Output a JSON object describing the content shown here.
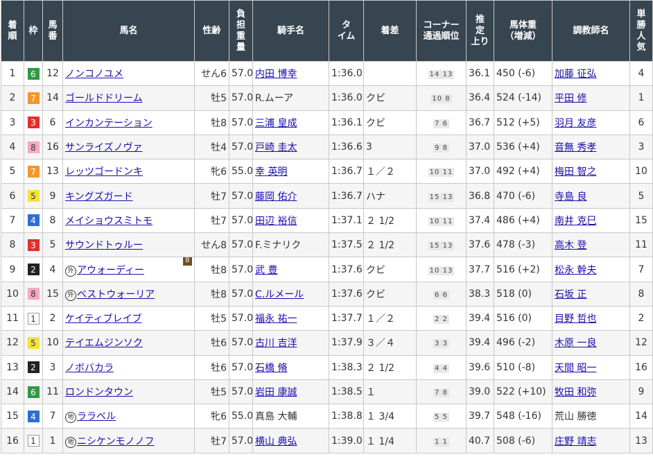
{
  "headers": [
    {
      "lines": [
        "着",
        "順"
      ]
    },
    {
      "lines": [
        "枠"
      ]
    },
    {
      "lines": [
        "馬",
        "番"
      ]
    },
    {
      "lines": [
        "馬名"
      ]
    },
    {
      "lines": [
        "性齢"
      ]
    },
    {
      "lines": [
        "負",
        "担",
        "重",
        "量"
      ]
    },
    {
      "lines": [
        "騎手名"
      ]
    },
    {
      "lines": [
        "タ",
        "イム"
      ]
    },
    {
      "lines": [
        "着差"
      ]
    },
    {
      "lines": [
        "コーナー",
        "通過順位"
      ]
    },
    {
      "lines": [
        "推",
        "定",
        "上り"
      ]
    },
    {
      "lines": [
        "馬体重",
        "（増減）"
      ]
    },
    {
      "lines": [
        "調教師名"
      ]
    },
    {
      "lines": [
        "単",
        "勝",
        "人",
        "気"
      ]
    }
  ],
  "waku_colors": {
    "1": {
      "bg": "#ffffff",
      "fg": "#333333",
      "border": "#999999"
    },
    "2": {
      "bg": "#222222",
      "fg": "#ffffff",
      "border": "#222222"
    },
    "3": {
      "bg": "#e0302c",
      "fg": "#ffffff",
      "border": "#e0302c"
    },
    "4": {
      "bg": "#2f6fcf",
      "fg": "#ffffff",
      "border": "#2f6fcf"
    },
    "5": {
      "bg": "#f5e23a",
      "fg": "#333333",
      "border": "#f5e23a"
    },
    "6": {
      "bg": "#2f9a45",
      "fg": "#ffffff",
      "border": "#2f9a45"
    },
    "7": {
      "bg": "#f5962a",
      "fg": "#ffffff",
      "border": "#f5962a"
    },
    "8": {
      "bg": "#f4a8c4",
      "fg": "#333333",
      "border": "#f4a8c4"
    }
  },
  "rows": [
    {
      "rank": "1",
      "waku": "6",
      "num": "12",
      "mark": "",
      "horse": "ノンコノユメ",
      "blinker": "",
      "sex_age": "せん6",
      "weight": "57.0",
      "jockey": "内田 博幸",
      "jockey_link": true,
      "time": "1:36.0",
      "margin": "",
      "corner": "14 13",
      "last3f": "36.1",
      "body_weight": "450 (-6)",
      "trainer": "加藤 征弘",
      "trainer_link": true,
      "pop": "4"
    },
    {
      "rank": "2",
      "waku": "7",
      "num": "14",
      "mark": "",
      "horse": "ゴールドドリーム",
      "blinker": "",
      "sex_age": "牡5",
      "weight": "57.0",
      "jockey": "R.ムーア",
      "jockey_link": false,
      "time": "1:36.0",
      "margin": "クビ",
      "corner": "10 8",
      "last3f": "36.4",
      "body_weight": "524 (-14)",
      "trainer": "平田 修",
      "trainer_link": true,
      "pop": "1"
    },
    {
      "rank": "3",
      "waku": "3",
      "num": "6",
      "mark": "",
      "horse": "インカンテーション",
      "blinker": "",
      "sex_age": "牡8",
      "weight": "57.0",
      "jockey": "三浦 皇成",
      "jockey_link": true,
      "time": "1:36.1",
      "margin": "クビ",
      "corner": "7 6",
      "last3f": "36.7",
      "body_weight": "512 (+5)",
      "trainer": "羽月 友彦",
      "trainer_link": true,
      "pop": "6"
    },
    {
      "rank": "4",
      "waku": "8",
      "num": "16",
      "mark": "",
      "horse": "サンライズノヴァ",
      "blinker": "",
      "sex_age": "牡4",
      "weight": "57.0",
      "jockey": "戸崎 圭太",
      "jockey_link": true,
      "time": "1:36.6",
      "margin": "3",
      "corner": "9 8",
      "last3f": "37.0",
      "body_weight": "536 (+4)",
      "trainer": "音無 秀孝",
      "trainer_link": true,
      "pop": "3"
    },
    {
      "rank": "5",
      "waku": "7",
      "num": "13",
      "mark": "",
      "horse": "レッツゴードンキ",
      "blinker": "",
      "sex_age": "牝6",
      "weight": "55.0",
      "jockey": "幸 英明",
      "jockey_link": true,
      "time": "1:36.7",
      "margin": "１／２",
      "corner": "10 11",
      "last3f": "37.0",
      "body_weight": "492 (+4)",
      "trainer": "梅田 智之",
      "trainer_link": true,
      "pop": "10"
    },
    {
      "rank": "6",
      "waku": "5",
      "num": "9",
      "mark": "",
      "horse": "キングズガード",
      "blinker": "",
      "sex_age": "牡7",
      "weight": "57.0",
      "jockey": "藤岡 佑介",
      "jockey_link": true,
      "time": "1:36.7",
      "margin": "ハナ",
      "corner": "15 13",
      "last3f": "36.8",
      "body_weight": "470 (-6)",
      "trainer": "寺島 良",
      "trainer_link": true,
      "pop": "5"
    },
    {
      "rank": "7",
      "waku": "4",
      "num": "8",
      "mark": "",
      "horse": "メイショウスミトモ",
      "blinker": "",
      "sex_age": "牡7",
      "weight": "57.0",
      "jockey": "田辺 裕信",
      "jockey_link": true,
      "time": "1:37.1",
      "margin": "２ 1/2",
      "corner": "10 11",
      "last3f": "37.4",
      "body_weight": "486 (+4)",
      "trainer": "南井 克巳",
      "trainer_link": true,
      "pop": "15"
    },
    {
      "rank": "8",
      "waku": "3",
      "num": "5",
      "mark": "",
      "horse": "サウンドトゥルー",
      "blinker": "",
      "sex_age": "せん8",
      "weight": "57.0",
      "jockey": "F.ミナリク",
      "jockey_link": false,
      "time": "1:37.5",
      "margin": "２ 1/2",
      "corner": "15 13",
      "last3f": "37.6",
      "body_weight": "478 (-3)",
      "trainer": "高木 登",
      "trainer_link": true,
      "pop": "11"
    },
    {
      "rank": "9",
      "waku": "2",
      "num": "4",
      "mark": "外",
      "horse": "アウォーディー",
      "blinker": "B",
      "sex_age": "牡8",
      "weight": "57.0",
      "jockey": "武 豊",
      "jockey_link": true,
      "time": "1:37.6",
      "margin": "クビ",
      "corner": "10 13",
      "last3f": "37.7",
      "body_weight": "516 (+2)",
      "trainer": "松永 幹夫",
      "trainer_link": true,
      "pop": "7"
    },
    {
      "rank": "10",
      "waku": "8",
      "num": "15",
      "mark": "外",
      "horse": "ベストウォーリア",
      "blinker": "",
      "sex_age": "牡8",
      "weight": "57.0",
      "jockey": "C.ルメール",
      "jockey_link": true,
      "time": "1:37.6",
      "margin": "クビ",
      "corner": "6 6",
      "last3f": "38.3",
      "body_weight": "518 (0)",
      "trainer": "石坂 正",
      "trainer_link": true,
      "pop": "8"
    },
    {
      "rank": "11",
      "waku": "1",
      "num": "2",
      "mark": "",
      "horse": "ケイティブレイブ",
      "blinker": "",
      "sex_age": "牡5",
      "weight": "57.0",
      "jockey": "福永 祐一",
      "jockey_link": true,
      "time": "1:37.7",
      "margin": "１／２",
      "corner": "2 2",
      "last3f": "39.4",
      "body_weight": "516 (0)",
      "trainer": "目野 哲也",
      "trainer_link": true,
      "pop": "2"
    },
    {
      "rank": "12",
      "waku": "5",
      "num": "10",
      "mark": "",
      "horse": "テイエムジンソク",
      "blinker": "",
      "sex_age": "牡6",
      "weight": "57.0",
      "jockey": "古川 吉洋",
      "jockey_link": true,
      "time": "1:37.9",
      "margin": "３／４",
      "corner": "3 3",
      "last3f": "39.4",
      "body_weight": "496 (-2)",
      "trainer": "木原 一良",
      "trainer_link": true,
      "pop": "12"
    },
    {
      "rank": "13",
      "waku": "2",
      "num": "3",
      "mark": "",
      "horse": "ノボバカラ",
      "blinker": "",
      "sex_age": "牡6",
      "weight": "57.0",
      "jockey": "石橋 脩",
      "jockey_link": true,
      "time": "1:38.3",
      "margin": "２ 1/2",
      "corner": "4 4",
      "last3f": "39.6",
      "body_weight": "510 (-8)",
      "trainer": "天間 昭一",
      "trainer_link": true,
      "pop": "16"
    },
    {
      "rank": "14",
      "waku": "6",
      "num": "11",
      "mark": "",
      "horse": "ロンドンタウン",
      "blinker": "",
      "sex_age": "牡5",
      "weight": "57.0",
      "jockey": "岩田 康誠",
      "jockey_link": true,
      "time": "1:38.5",
      "margin": "１",
      "corner": "7 8",
      "last3f": "39.0",
      "body_weight": "522 (+10)",
      "trainer": "牧田 和弥",
      "trainer_link": true,
      "pop": "9"
    },
    {
      "rank": "15",
      "waku": "4",
      "num": "7",
      "mark": "地",
      "horse": "ララベル",
      "blinker": "",
      "sex_age": "牝6",
      "weight": "55.0",
      "jockey": "真島 大輔",
      "jockey_link": false,
      "time": "1:38.8",
      "margin": "１ 3/4",
      "corner": "5 5",
      "last3f": "39.7",
      "body_weight": "548 (-16)",
      "trainer": "荒山 勝徳",
      "trainer_link": false,
      "pop": "14"
    },
    {
      "rank": "16",
      "waku": "1",
      "num": "1",
      "mark": "地",
      "horse": "ニシケンモノノフ",
      "blinker": "",
      "sex_age": "牡7",
      "weight": "57.0",
      "jockey": "横山 典弘",
      "jockey_link": true,
      "time": "1:39.0",
      "margin": "１ 1/4",
      "corner": "1 1",
      "last3f": "40.7",
      "body_weight": "508 (-6)",
      "trainer": "庄野 靖志",
      "trainer_link": true,
      "pop": "13"
    }
  ]
}
